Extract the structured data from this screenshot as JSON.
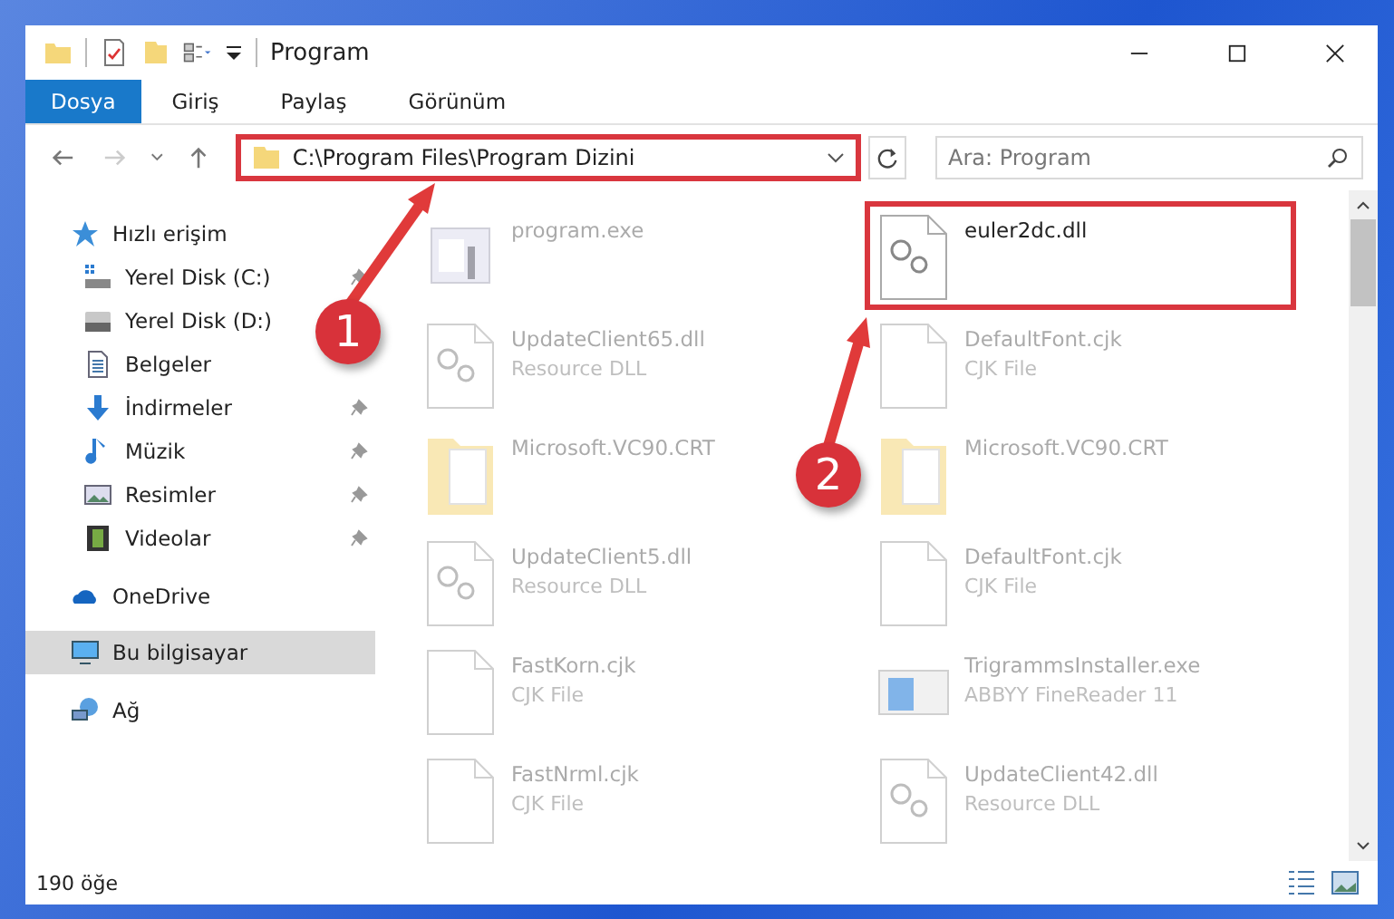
{
  "window": {
    "title": "Program"
  },
  "ribbon_tabs": [
    {
      "label": "Dosya",
      "selected": true
    },
    {
      "label": "Giriş",
      "selected": false
    },
    {
      "label": "Paylaş",
      "selected": false
    },
    {
      "label": "Görünüm",
      "selected": false
    }
  ],
  "address_bar": {
    "path": "C:\\Program Files\\Program Dizini",
    "highlighted": true
  },
  "search": {
    "placeholder": "Ara: Program"
  },
  "sidebar": {
    "items": [
      {
        "label": "Hızlı erişim",
        "kind": "star",
        "selected": false,
        "children": [
          {
            "label": "Yerel Disk (C:)",
            "kind": "disk-c",
            "pinned": true,
            "selected": false
          },
          {
            "label": "Yerel Disk (D:)",
            "kind": "disk",
            "selected": false
          },
          {
            "label": "Belgeler",
            "kind": "docs",
            "selected": false
          },
          {
            "label": "İndirmeler",
            "kind": "download",
            "pinned": true,
            "selected": false
          },
          {
            "label": "Müzik",
            "kind": "music",
            "pinned": true,
            "selected": false
          },
          {
            "label": "Resimler",
            "kind": "pictures",
            "pinned": true,
            "selected": false
          },
          {
            "label": "Videolar",
            "kind": "video",
            "pinned": true,
            "selected": false
          }
        ]
      },
      {
        "label": "OneDrive",
        "kind": "cloud",
        "selected": false
      },
      {
        "label": "Bu bilgisayar",
        "kind": "pc",
        "selected": true
      },
      {
        "label": "Ağ",
        "kind": "network",
        "selected": false
      }
    ]
  },
  "files": [
    {
      "name": "program.exe",
      "kind": "exe",
      "blurred": true,
      "highlighted": false
    },
    {
      "name": "euler2dc.dll",
      "kind": "dll",
      "blurred": false,
      "highlighted": true
    },
    {
      "name": "UpdateClient65.dll",
      "type": "Resource DLL",
      "kind": "dll",
      "blurred": true,
      "highlighted": false
    },
    {
      "name": "DefaultFont.cjk",
      "type": "CJK File",
      "kind": "file",
      "blurred": true,
      "highlighted": false
    },
    {
      "name": "Microsoft.VC90.CRT",
      "kind": "folder",
      "blurred": true,
      "highlighted": false
    },
    {
      "name": "Microsoft.VC90.CRT",
      "kind": "folder",
      "blurred": true,
      "highlighted": false
    },
    {
      "name": "UpdateClient5.dll",
      "type": "Resource DLL",
      "kind": "dll",
      "blurred": true,
      "highlighted": false
    },
    {
      "name": "DefaultFont.cjk",
      "type": "CJK File",
      "kind": "file",
      "blurred": true,
      "highlighted": false
    },
    {
      "name": "FastKorn.cjk",
      "type": "CJK File",
      "kind": "file",
      "blurred": true,
      "highlighted": false
    },
    {
      "name": "TrigrammsInstaller.exe",
      "type": "ABBYY FineReader 11",
      "kind": "installer",
      "blurred": true,
      "highlighted": false
    },
    {
      "name": "FastNrml.cjk",
      "type": "CJK File",
      "kind": "file",
      "blurred": true,
      "highlighted": false
    },
    {
      "name": "UpdateClient42.dll",
      "type": "Resource DLL",
      "kind": "dll",
      "blurred": true,
      "highlighted": false
    }
  ],
  "status_bar": {
    "count": "190 öğe"
  },
  "annotations": [
    {
      "number": "1"
    },
    {
      "number": "2"
    }
  ]
}
